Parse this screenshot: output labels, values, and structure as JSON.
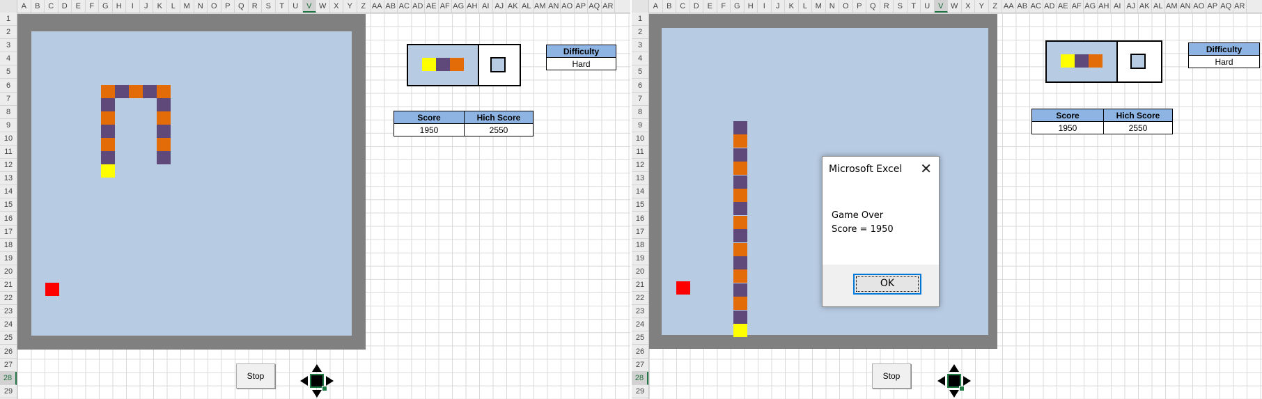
{
  "columns": [
    "A",
    "B",
    "C",
    "D",
    "E",
    "F",
    "G",
    "H",
    "I",
    "J",
    "K",
    "L",
    "M",
    "N",
    "O",
    "P",
    "Q",
    "R",
    "S",
    "T",
    "U",
    "V",
    "W",
    "X",
    "Y",
    "Z",
    "AA",
    "AB",
    "AC",
    "AD",
    "AE",
    "AF",
    "AG",
    "AH",
    "AI",
    "AJ",
    "AK",
    "AL",
    "AM",
    "AN",
    "AO",
    "AP",
    "AQ",
    "AR"
  ],
  "selected_column": "V",
  "rows": [
    "1",
    "2",
    "3",
    "4",
    "5",
    "6",
    "7",
    "8",
    "9",
    "10",
    "11",
    "12",
    "13",
    "14",
    "15",
    "16",
    "17",
    "18",
    "19",
    "20",
    "21",
    "22",
    "23",
    "24",
    "25",
    "26",
    "27",
    "28",
    "29"
  ],
  "selected_row": "28",
  "colors": {
    "board_bg": "#b7cbe3",
    "frame": "#808080",
    "snake_purple": "#5f497a",
    "snake_orange": "#e36c09",
    "snake_head": "#ffff00",
    "food": "#ff0000",
    "header_fill": "#8db4e2"
  },
  "left": {
    "difficulty": {
      "header": "Difficulty",
      "value": "Hard"
    },
    "scoreboard": {
      "score_header": "Score",
      "high_header": "Hich Score",
      "score": "1950",
      "high": "2550"
    },
    "stop_label": "Stop"
  },
  "right": {
    "difficulty": {
      "header": "Difficulty",
      "value": "Hard"
    },
    "scoreboard": {
      "score_header": "Score",
      "high_header": "Hich Score",
      "score": "1950",
      "high": "2550"
    },
    "stop_label": "Stop",
    "dialog": {
      "title": "Microsoft Excel",
      "close": "✕",
      "line1": "Game Over",
      "line2": "Score = 1950",
      "ok_label": "OK"
    }
  }
}
